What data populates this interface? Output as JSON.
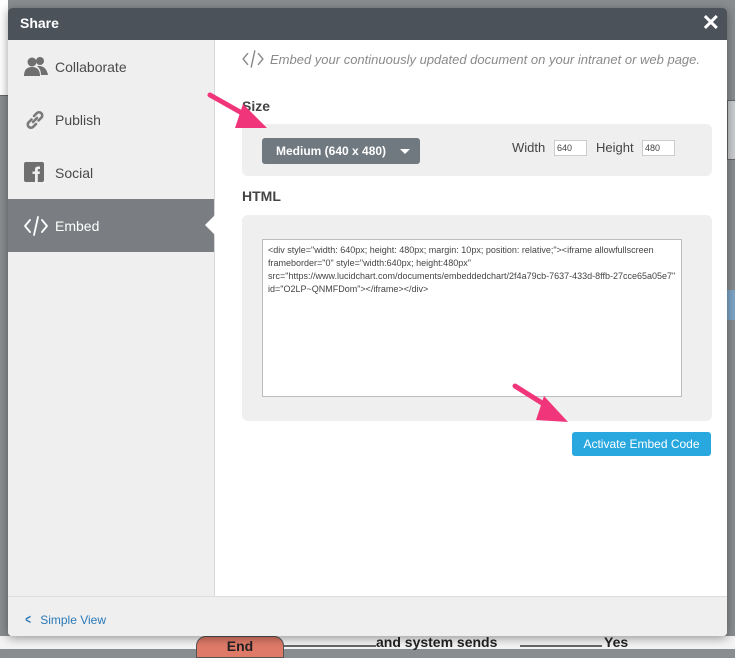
{
  "background": {
    "end_label": "End",
    "sends_label": "and system sends",
    "yes_label": "Yes"
  },
  "dialog": {
    "title": "Share",
    "close_glyph": "✕"
  },
  "sidebar": {
    "items": [
      {
        "label": "Collaborate",
        "icon": "people-icon"
      },
      {
        "label": "Publish",
        "icon": "link-icon"
      },
      {
        "label": "Social",
        "icon": "facebook-icon"
      },
      {
        "label": "Embed",
        "icon": "code-icon",
        "active": true
      }
    ]
  },
  "main": {
    "description": "Embed your continuously updated document on your intranet or web page.",
    "size_label": "Size",
    "size_selected": "Medium (640 x 480)",
    "width_label": "Width",
    "width_value": "640",
    "height_label": "Height",
    "height_value": "480",
    "html_label": "HTML",
    "html_code": "<div style=\"width: 640px; height: 480px; margin: 10px; position: relative;\"><iframe allowfullscreen frameborder=\"0\" style=\"width:640px; height:480px\" src=\"https://www.lucidchart.com/documents/embeddedchart/2f4a79cb-7637-433d-8ffb-27cce65a05e7\" id=\"O2LP~QNMFDom\"></iframe></div>",
    "activate_button": "Activate Embed Code"
  },
  "footer": {
    "simple_view": "Simple View"
  },
  "colors": {
    "header_bg": "#4b5259",
    "active_tab": "#7a7e82",
    "primary_button": "#29a8e0",
    "annotation_arrow": "#f0357a"
  }
}
